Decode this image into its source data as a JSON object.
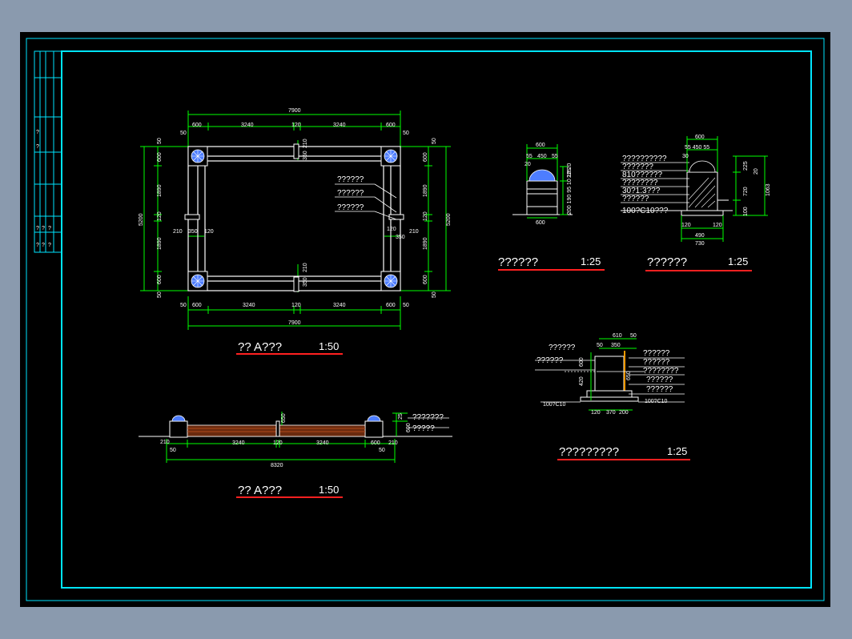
{
  "colors": {
    "frame": "#00e5ff",
    "wall": "#ffffff",
    "dimension": "#00ff00",
    "title_underline": "#ff2020",
    "pillar_cap": "#4d7dff",
    "brick": "#b04a1a"
  },
  "title_block": {
    "marks": [
      "?",
      "?",
      "?",
      "?",
      "?",
      "?",
      "?",
      "?"
    ]
  },
  "plan": {
    "title": "?? A???",
    "scale": "1:50",
    "top_overall": "7900",
    "top_segments": [
      "600",
      "3240",
      "120",
      "3240",
      "600"
    ],
    "edge_50_left": "50",
    "edge_50_right": "50",
    "left_overall": "5200",
    "left_segments": [
      "600",
      "1890",
      "120",
      "1890",
      "600"
    ],
    "left_edge_50_top": "50",
    "left_edge_50_bottom": "50",
    "right_overall": "5200",
    "right_segments": [
      "600",
      "1890",
      "120",
      "1890",
      "600"
    ],
    "right_edge_50_top": "50",
    "right_edge_50_bottom": "50",
    "bottom_overall": "7900",
    "bottom_segments": [
      "600",
      "3240",
      "120",
      "3240",
      "600"
    ],
    "wall_210_a": "210",
    "wall_350_a": "350",
    "wall_120_a": "120",
    "wall_210_b": "210",
    "wall_120_b": "120",
    "wall_350_b": "350",
    "notch_210_top": "210",
    "notch_350_top": "350",
    "notch_210_bottom": "210",
    "notch_350_bottom": "350",
    "callouts": [
      "??????",
      "??????",
      "??????"
    ]
  },
  "elevation": {
    "title": "?? A???",
    "scale": "1:50",
    "segments": [
      "3240",
      "120",
      "3240"
    ],
    "left_210": "210",
    "left_50": "50",
    "right_600": "600",
    "right_210": "210",
    "right_50": "50",
    "overall": "8320",
    "height_650": "650",
    "height_25": "25",
    "height_600": "600",
    "callouts": [
      "???????",
      "?????"
    ]
  },
  "detail_a": {
    "title": "??????",
    "scale": "1:25",
    "width_top": "600",
    "sub_55a": "55",
    "sub_450": "450",
    "sub_55b": "55",
    "sub_20": "20",
    "right_dims": "225",
    "right_stack": "200 190 95 10 10 20",
    "width_bottom": "600"
  },
  "detail_b": {
    "title": "??????",
    "scale": "1:25",
    "width_top": "600",
    "sub_top": "55  450  55",
    "sub_30": "30",
    "layers": [
      "??????????",
      "???????",
      "810??????",
      "????????",
      "30?1:3???",
      "??????",
      "100?C10???"
    ],
    "right_225": "225",
    "right_20": "20",
    "right_720": "720",
    "right_1063": "1063",
    "right_100": "100",
    "bottom_120a": "120",
    "bottom_120b": "120",
    "bottom_490": "490",
    "bottom_730": "730"
  },
  "detail_c": {
    "title": "?????????",
    "scale": "1:25",
    "top_610": "610",
    "top_50": "50",
    "top_350": "350",
    "top_50b": "50",
    "left_callouts": [
      "??????",
      "??????"
    ],
    "right_callouts": [
      "??????",
      "??????",
      "????????",
      "??????",
      "??????"
    ],
    "left_foot": "100?C10",
    "right_foot": "100?C10",
    "bottom_dims": [
      "120",
      "370",
      "200"
    ],
    "side_dims": [
      "600",
      "420",
      "650"
    ]
  }
}
